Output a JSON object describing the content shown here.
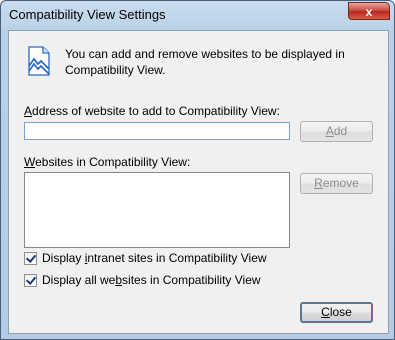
{
  "window": {
    "title": "Compatibility View Settings",
    "close_glyph": "x"
  },
  "info": {
    "icon": "compatibility-view-icon",
    "text": "You can add and remove websites to be displayed in Compatibility View."
  },
  "add_section": {
    "label_prefix": "",
    "label_accel": "A",
    "label_rest": "ddress of website to add to Compatibility View:",
    "input_value": "",
    "add_button_accel": "A",
    "add_button_rest": "dd",
    "add_button_enabled": false
  },
  "list_section": {
    "label_accel": "W",
    "label_rest": "ebsites in Compatibility View:",
    "items": [],
    "remove_button_accel": "R",
    "remove_button_rest": "emove",
    "remove_button_enabled": false
  },
  "options": [
    {
      "prefix": "Display ",
      "accel": "i",
      "rest": "ntranet sites in Compatibility View",
      "checked": true
    },
    {
      "prefix": "Display all we",
      "accel": "b",
      "rest": "sites in Compatibility View",
      "checked": true
    }
  ],
  "footer": {
    "close_accel": "C",
    "close_rest": "lose"
  },
  "colors": {
    "frame": "#b9d1e8",
    "client": "#f0f0f0",
    "icon_blue": "#2e6bbd",
    "close_red": "#c8463a"
  }
}
